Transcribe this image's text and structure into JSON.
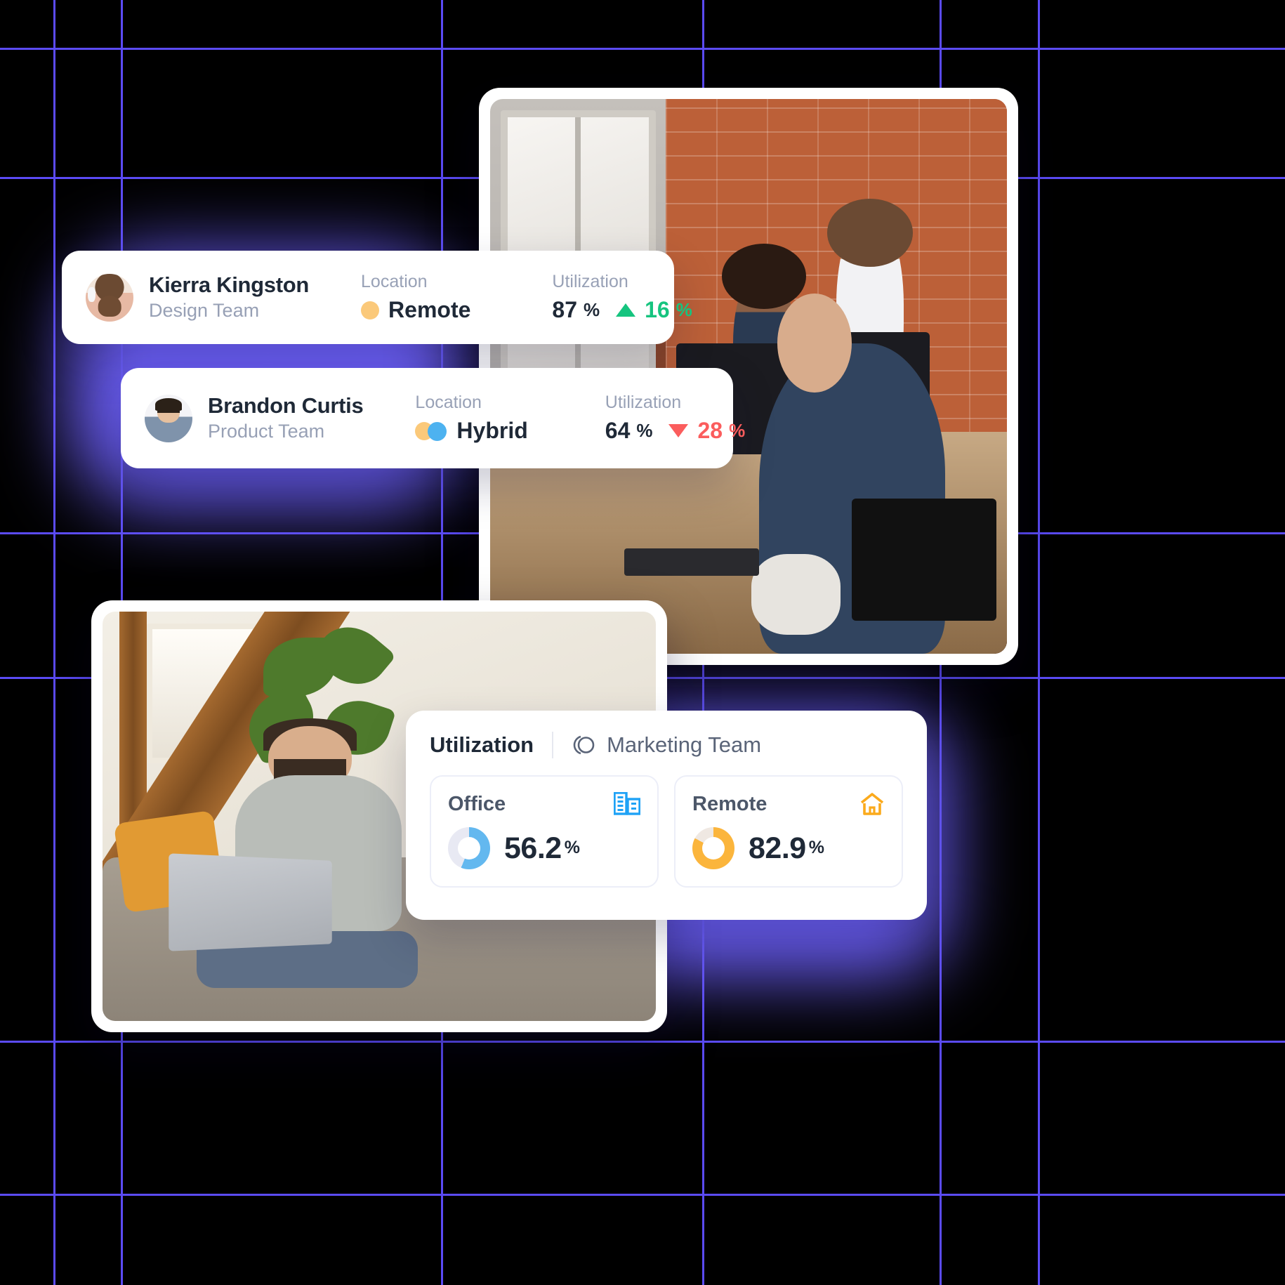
{
  "theme": {
    "background": "#000000",
    "grid_line": "#5b4bf5",
    "glow": "#6c5ff7",
    "accent_blue": "#3aa9f0",
    "accent_amber": "#fbb03b",
    "positive": "#16c47f",
    "negative": "#fb5d5d"
  },
  "member_cards": [
    {
      "avatar": "avatar-kierra",
      "name": "Kierra Kingston",
      "team": "Design Team",
      "location_label": "Location",
      "location_value": "Remote",
      "location_icon": "circle-amber-icon",
      "utilization_label": "Utilization",
      "utilization_value": "87",
      "utilization_unit": "%",
      "delta_direction": "up",
      "delta_icon": "triangle-up-icon",
      "delta_value": "16",
      "delta_unit": "%"
    },
    {
      "avatar": "avatar-brandon",
      "name": "Brandon Curtis",
      "team": "Product Team",
      "location_label": "Location",
      "location_value": "Hybrid",
      "location_icon": "two-circles-icon",
      "utilization_label": "Utilization",
      "utilization_value": "64",
      "utilization_unit": "%",
      "delta_direction": "down",
      "delta_icon": "triangle-down-icon",
      "delta_value": "28",
      "delta_unit": "%"
    }
  ],
  "utilization_panel": {
    "title": "Utilization",
    "team_icon": "rings-icon",
    "team_label": "Marketing Team",
    "tiles": [
      {
        "label": "Office",
        "icon": "office-building-icon",
        "icon_color": "#1fa2f6",
        "value": "56.2",
        "unit": "%",
        "percent": 56.2,
        "ring_color": "#63b8ef",
        "track_color": "#e8e9f3"
      },
      {
        "label": "Remote",
        "icon": "home-icon",
        "icon_color": "#fbaa1c",
        "value": "82.9",
        "unit": "%",
        "percent": 82.9,
        "ring_color": "#fbb53c",
        "track_color": "#efe8e2"
      }
    ]
  },
  "chart_data": {
    "type": "pie",
    "title": "Utilization — Marketing Team",
    "categories": [
      "Office",
      "Remote"
    ],
    "values": [
      56.2,
      82.9
    ],
    "unit": "%",
    "ylim": [
      0,
      100
    ]
  },
  "photos": [
    {
      "name": "office-team-photo",
      "alt": "Team working at desks in a brick-walled office"
    },
    {
      "name": "remote-worker-photo",
      "alt": "Man with laptop sitting on a couch at home"
    }
  ]
}
